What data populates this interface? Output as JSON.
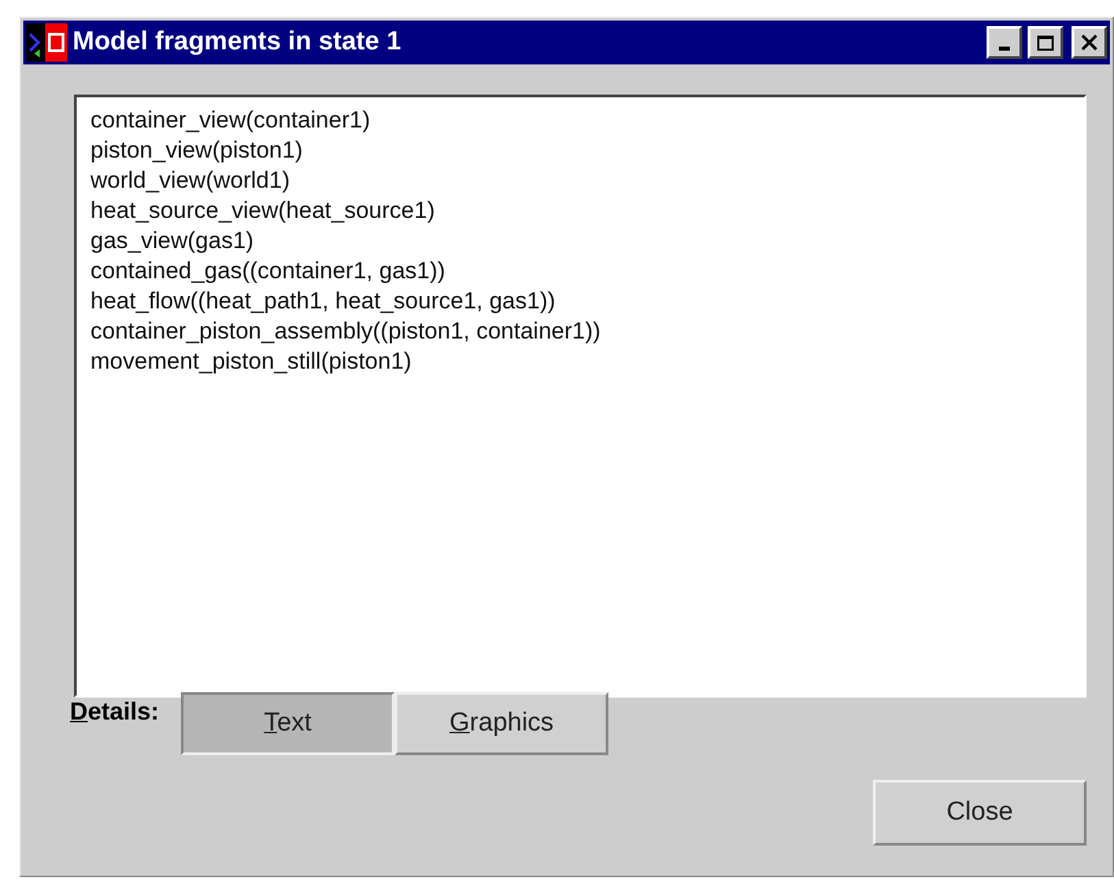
{
  "window": {
    "title": "Model fragments in state 1"
  },
  "fragments": [
    "container_view(container1)",
    "piston_view(piston1)",
    "world_view(world1)",
    "heat_source_view(heat_source1)",
    "gas_view(gas1)",
    "contained_gas((container1, gas1))",
    "heat_flow((heat_path1, heat_source1, gas1))",
    "container_piston_assembly((piston1, container1))",
    "movement_piston_still(piston1)"
  ],
  "details": {
    "label": "Details:",
    "options": [
      {
        "label": "Text",
        "selected": true
      },
      {
        "label": "Graphics",
        "selected": false
      }
    ]
  },
  "buttons": [
    "Close"
  ]
}
